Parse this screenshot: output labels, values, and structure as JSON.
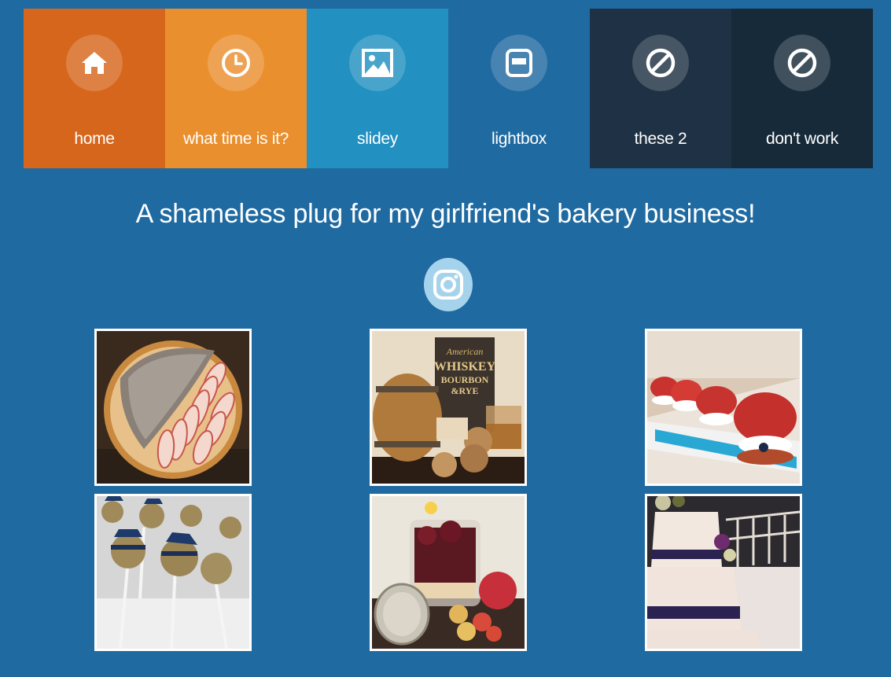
{
  "nav": {
    "items": [
      {
        "label": "home",
        "icon": "home-icon",
        "color": "#d6661c"
      },
      {
        "label": "what time is it?",
        "icon": "clock-icon",
        "color": "#ea8f2e"
      },
      {
        "label": "slidey",
        "icon": "image-icon",
        "color": "#2290c0"
      },
      {
        "label": "lightbox",
        "icon": "window-icon",
        "color": "#1f6aa1"
      },
      {
        "label": "these 2",
        "icon": "blocked-icon",
        "color": "#1f3144"
      },
      {
        "label": "don't work",
        "icon": "blocked-icon",
        "color": "#172a39"
      }
    ]
  },
  "headline": "A shameless plug for my girlfriend's bakery business!",
  "instagram": {
    "icon": "instagram-icon",
    "color": "#a6d3ec"
  },
  "gallery": {
    "photos": [
      {
        "subject": "apple tart with crumble topping"
      },
      {
        "subject": "whiskey book, barrel and cookies"
      },
      {
        "subject": "red macaron-style pastries on blue sugar"
      },
      {
        "subject": "graduation cap cake pops"
      },
      {
        "subject": "jar of cherry dessert with fruit"
      },
      {
        "subject": "wedding cake with purple ribbon"
      }
    ],
    "book_text": [
      "American",
      "WHISKEY",
      "BOURBON",
      "&RYE"
    ]
  }
}
